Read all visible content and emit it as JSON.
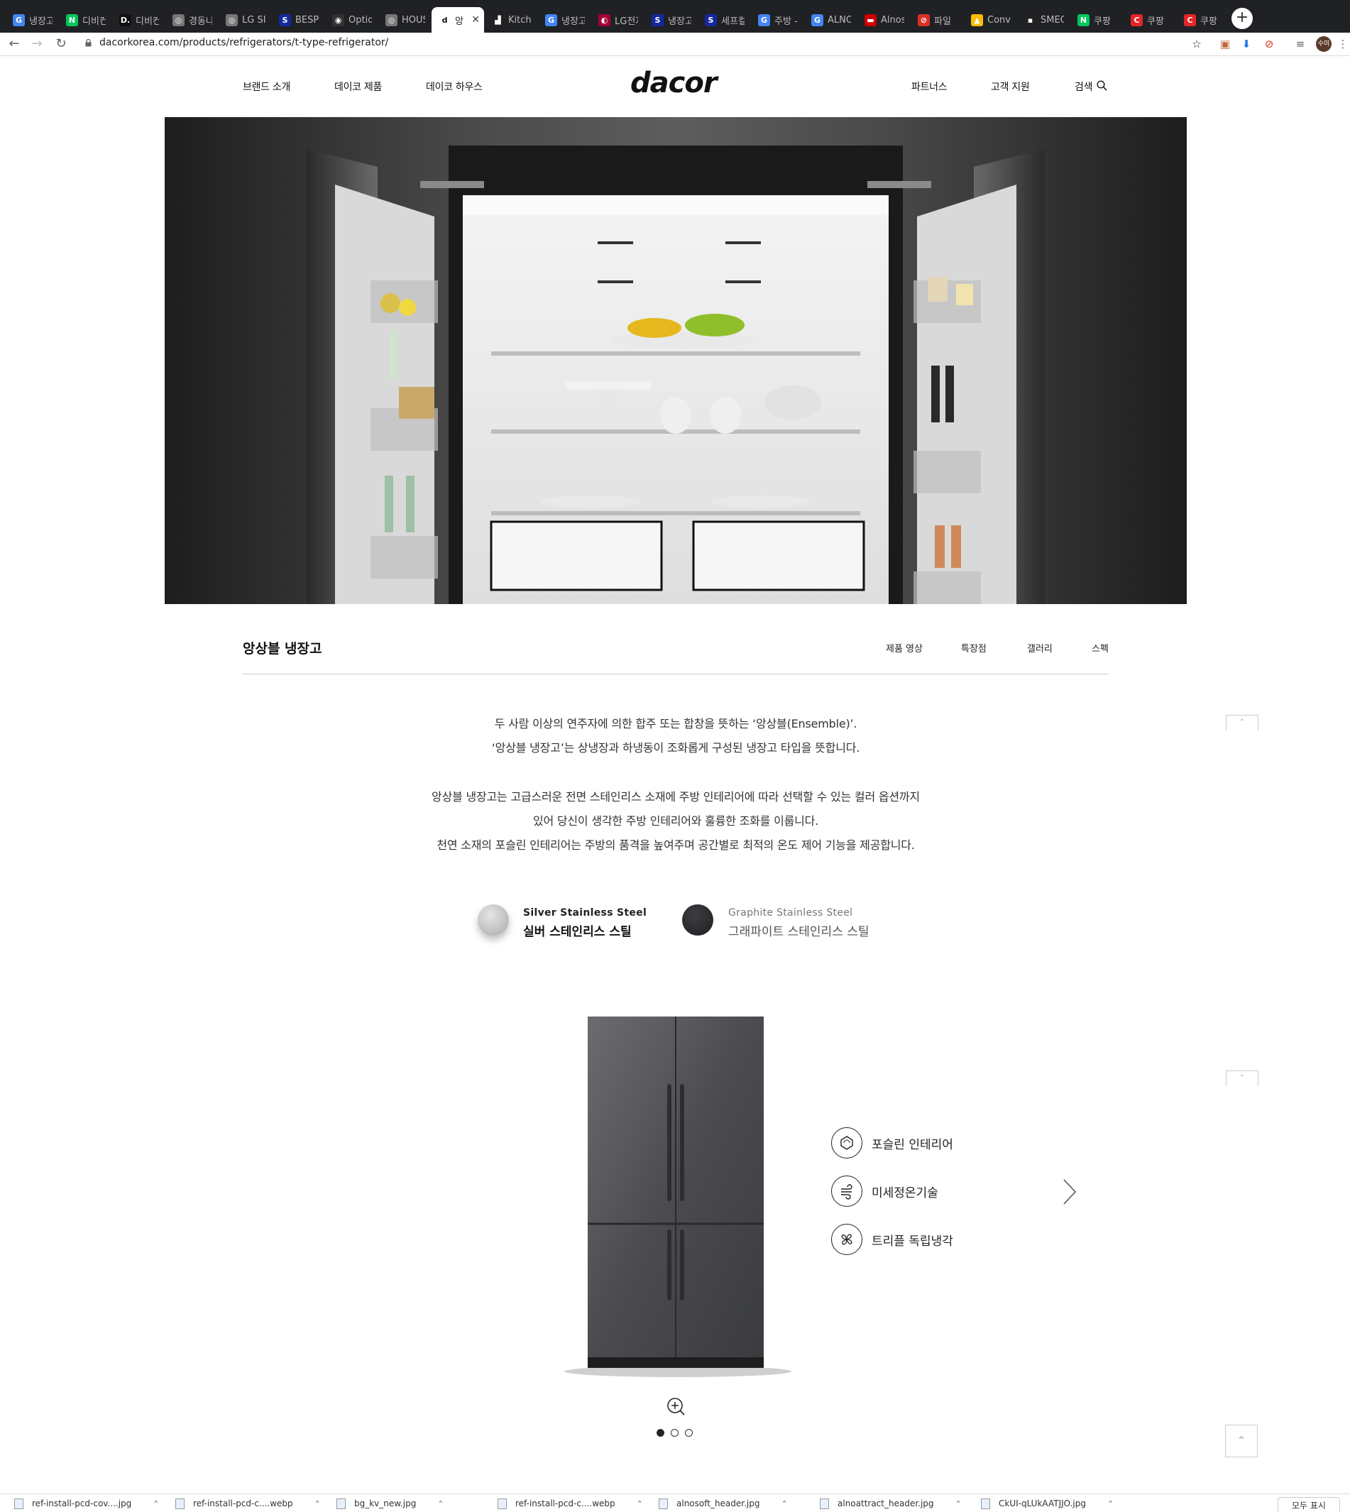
{
  "browser": {
    "tabs": [
      {
        "label": "냉장고",
        "icon": "google-icon",
        "color": "#4285f4",
        "glyph": "G"
      },
      {
        "label": "디비컨",
        "icon": "naver-icon",
        "color": "#03c75a",
        "glyph": "N"
      },
      {
        "label": "디비컨",
        "icon": "dbkorea-icon",
        "color": "#111111",
        "glyph": "D."
      },
      {
        "label": "경동나",
        "icon": "globe-icon",
        "color": "#777777",
        "glyph": "◎"
      },
      {
        "label": "LG SIG",
        "icon": "globe-icon",
        "color": "#777777",
        "glyph": "◎"
      },
      {
        "label": "BESPO",
        "icon": "samsung-icon",
        "color": "#1428a0",
        "glyph": "S"
      },
      {
        "label": "Option",
        "icon": "github-icon",
        "color": "#333333",
        "glyph": "◉"
      },
      {
        "label": "HOUS",
        "icon": "globe-icon",
        "color": "#777777",
        "glyph": "◎"
      },
      {
        "label": "앙",
        "icon": "dacor-icon",
        "color": "#ffffff",
        "glyph": "d",
        "active": true
      },
      {
        "label": "Kitche",
        "icon": "kitchen-icon",
        "color": "#222222",
        "glyph": "▟"
      },
      {
        "label": "냉장고",
        "icon": "google-icon",
        "color": "#4285f4",
        "glyph": "G"
      },
      {
        "label": "LG전자",
        "icon": "lg-icon",
        "color": "#a50034",
        "glyph": "◐"
      },
      {
        "label": "냉장고",
        "icon": "samsung-icon",
        "color": "#1428a0",
        "glyph": "S"
      },
      {
        "label": "세프컬",
        "icon": "samsung-icon",
        "color": "#1428a0",
        "glyph": "S"
      },
      {
        "label": "주방 -",
        "icon": "google-icon",
        "color": "#4285f4",
        "glyph": "G"
      },
      {
        "label": "ALNO",
        "icon": "google-icon",
        "color": "#4285f4",
        "glyph": "G"
      },
      {
        "label": "Alnosi",
        "icon": "alno-icon",
        "color": "#cc0000",
        "glyph": "▬"
      },
      {
        "label": "파일",
        "icon": "block-icon",
        "color": "#d93025",
        "glyph": "⊘"
      },
      {
        "label": "Conve",
        "icon": "drive-icon",
        "color": "#fbbc04",
        "glyph": "▲"
      },
      {
        "label": "SMEG",
        "icon": "smeg-icon",
        "color": "#222222",
        "glyph": "▪"
      },
      {
        "label": "쿠팡",
        "icon": "naver-icon",
        "color": "#03c75a",
        "glyph": "N"
      },
      {
        "label": "쿠팡",
        "icon": "coupang-icon",
        "color": "#e52528",
        "glyph": "C"
      },
      {
        "label": "쿠팡",
        "icon": "coupang-icon",
        "color": "#e52528",
        "glyph": "C"
      }
    ],
    "url": "dacorkorea.com/products/refrigerators/t-type-refrigerator/",
    "profile_label": "수미"
  },
  "header": {
    "nav_left": [
      "브랜드 소개",
      "데이코 제품",
      "데이코 하우스"
    ],
    "logo": "dacor",
    "nav_right": [
      "파트너스",
      "고객 지원",
      "검색"
    ]
  },
  "product": {
    "title": "앙상블 냉장고",
    "subnav": [
      "제품 영상",
      "특장점",
      "갤러리",
      "스펙"
    ],
    "intro_lines": [
      "두 사람 이상의 연주자에 의한 합주 또는 합창을 뜻하는 ‘앙상블(Ensemble)’.",
      "‘앙상블 냉장고’는 상냉장과 하냉동이 조화롭게 구성된 냉장고 타입을 뜻합니다."
    ],
    "detail_lines": [
      "앙상블 냉장고는 고급스러운 전면 스테인리스 소재에 주방 인테리어에 따라 선택할 수 있는 컬러 옵션까지",
      "있어 당신이 생각한 주방 인테리어와 훌륭한 조화를 이룹니다.",
      "천연 소재의 포슬린 인테리어는 주방의 품격을 높여주며 공간별로 최적의 온도 제어 기능을 제공합니다."
    ],
    "colors": [
      {
        "en": "Silver Stainless Steel",
        "ko": "실버 스테인리스 스틸",
        "hex": "#b8b9bb",
        "selected": true
      },
      {
        "en": "Graphite Stainless Steel",
        "ko": "그래파이트 스테인리스 스틸",
        "hex": "#2b2c2f",
        "selected": false
      }
    ],
    "features": [
      {
        "label": "포슬린 인테리어",
        "icon": "porcelain-icon"
      },
      {
        "label": "미세정온기술",
        "icon": "airflow-icon"
      },
      {
        "label": "트리플 독립냉각",
        "icon": "fan-icon"
      }
    ],
    "carousel": {
      "count": 3,
      "active": 0
    }
  },
  "downloads": [
    "ref-install-pcd-cov....jpg",
    "ref-install-pcd-c....webp",
    "bg_kv_new.jpg",
    "ref-install-pcd-c....webp",
    "alnosoft_header.jpg",
    "alnoattract_header.jpg",
    "CkUI-qLUkAATJJO.jpg"
  ],
  "downloads_show_all": "모두 표시"
}
